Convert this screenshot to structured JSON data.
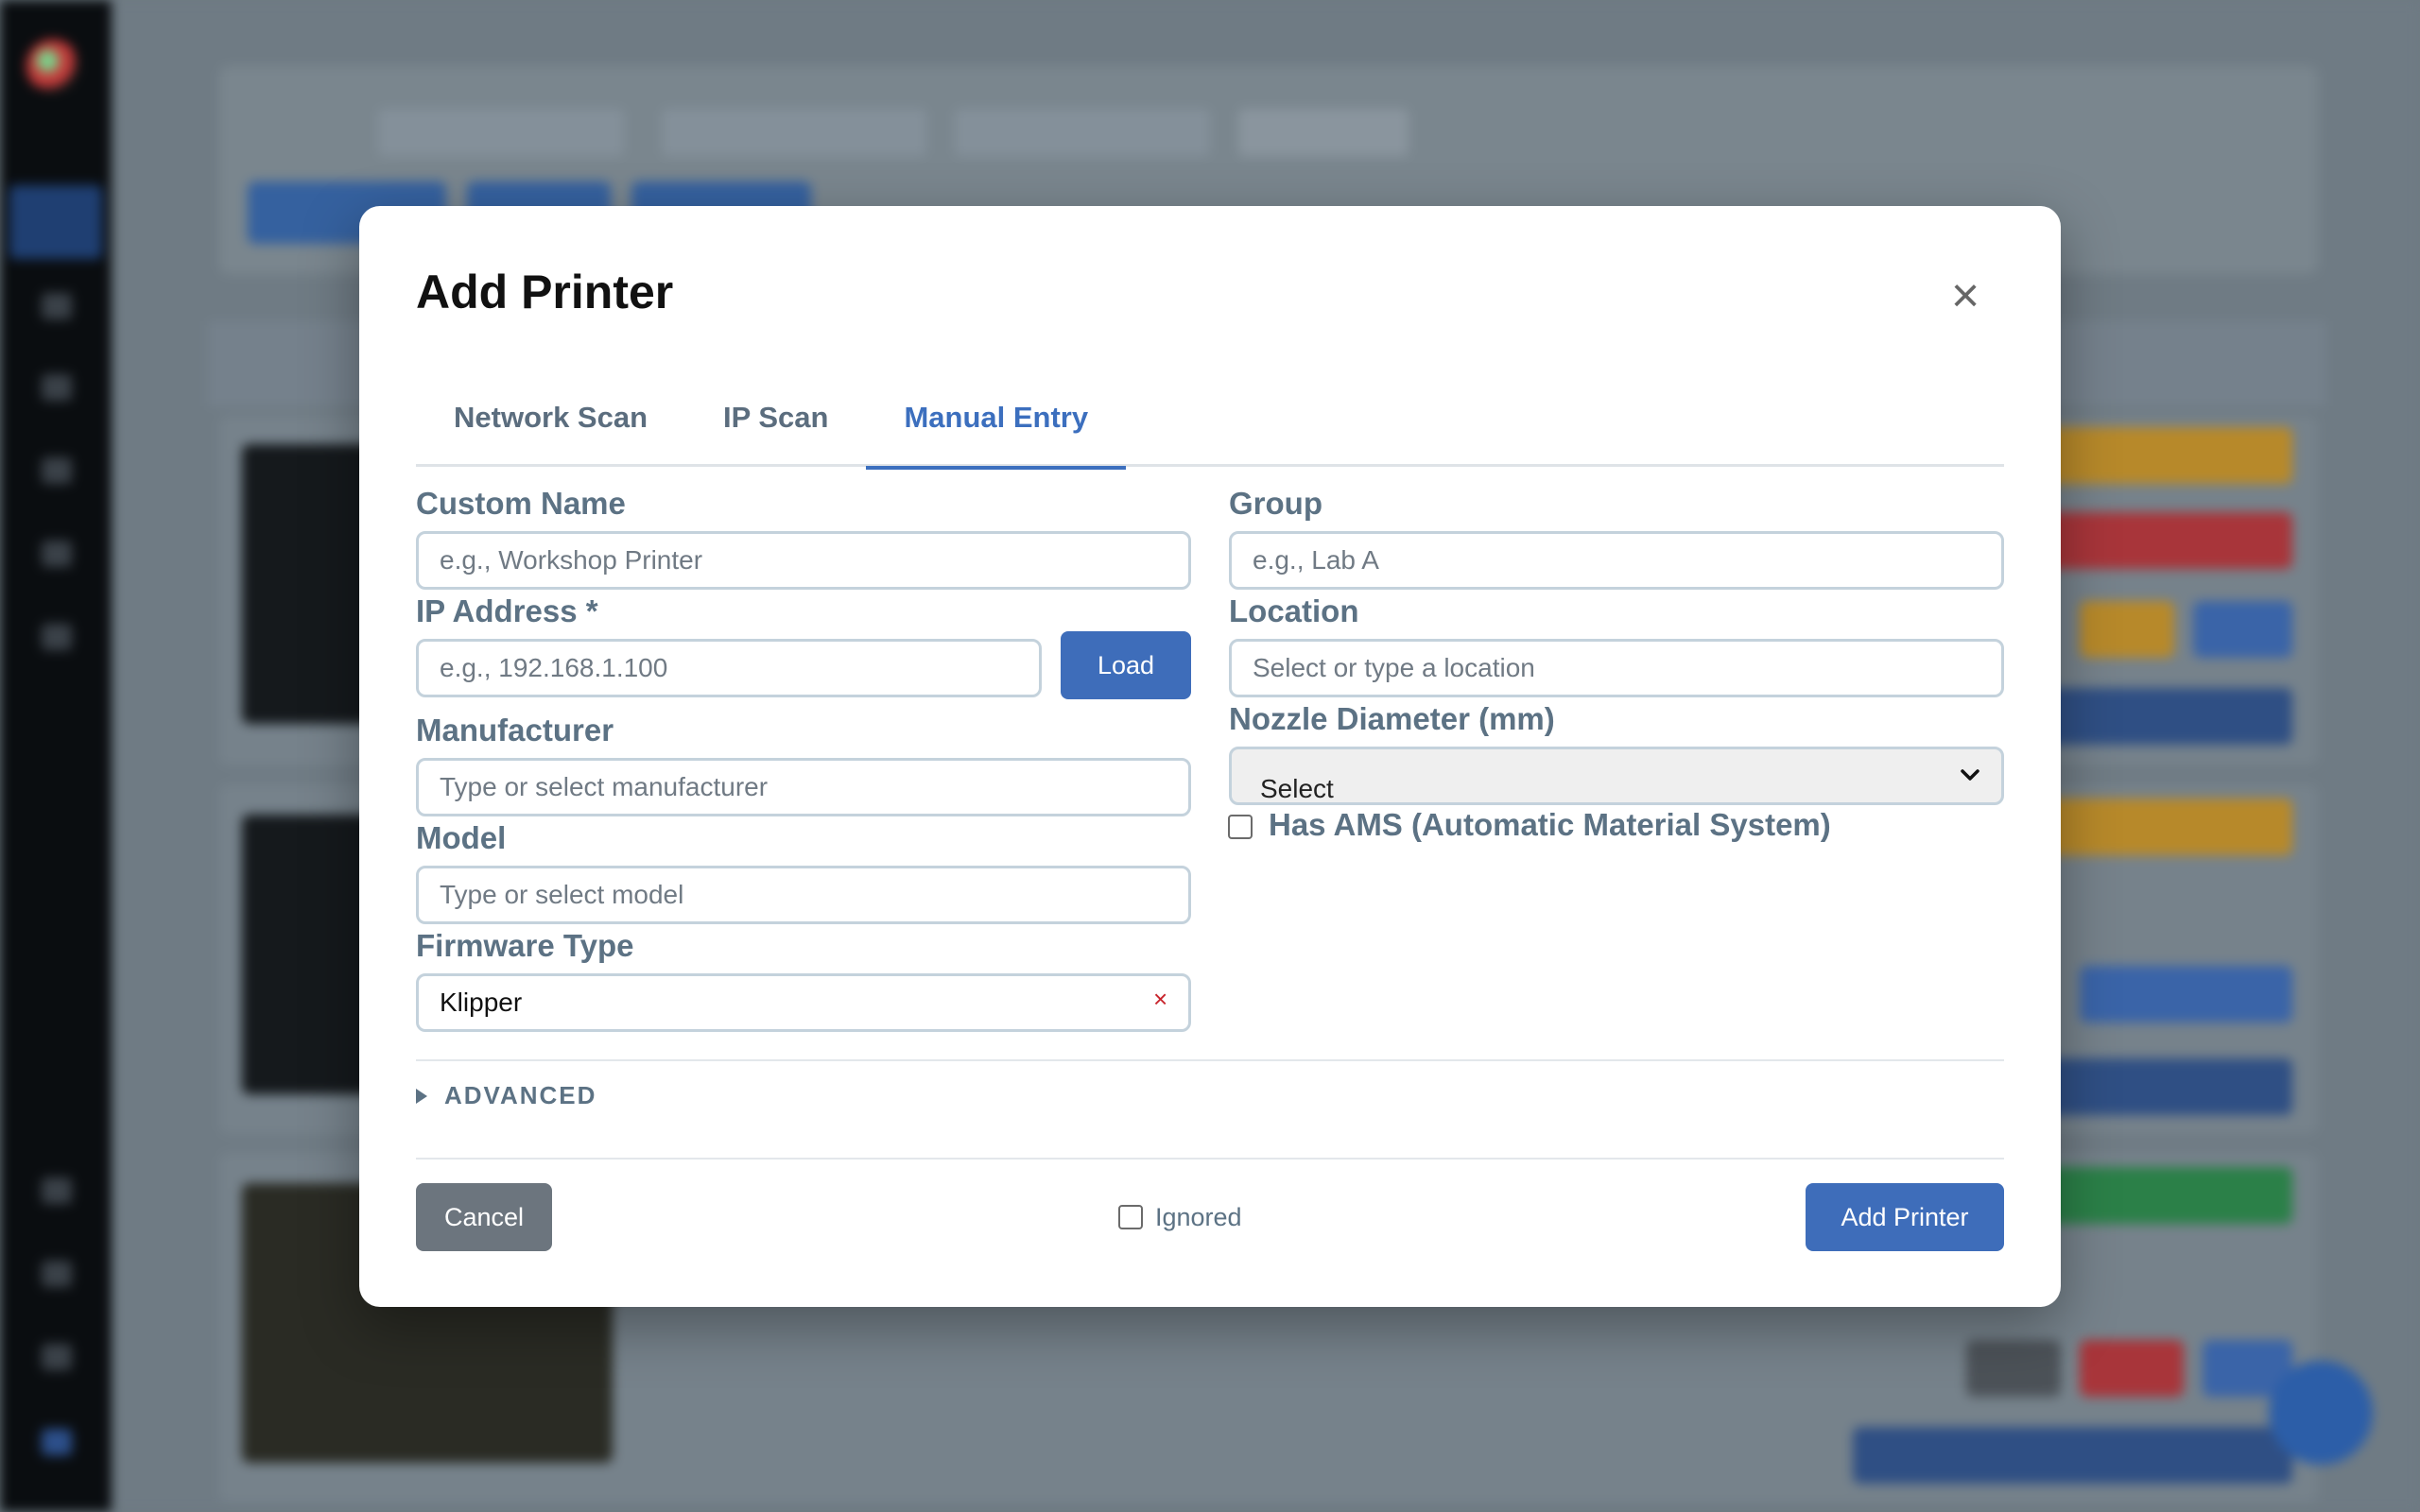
{
  "modal": {
    "title": "Add Printer",
    "close_symbol": "×",
    "tabs": [
      {
        "label": "Network Scan",
        "active": false
      },
      {
        "label": "IP Scan",
        "active": false
      },
      {
        "label": "Manual Entry",
        "active": true
      }
    ]
  },
  "form": {
    "custom_name": {
      "label": "Custom Name",
      "placeholder": "e.g., Workshop Printer",
      "value": ""
    },
    "ip_address": {
      "label": "IP Address *",
      "placeholder": "e.g., 192.168.1.100",
      "value": ""
    },
    "load_button": "Load",
    "manufacturer": {
      "label": "Manufacturer",
      "placeholder": "Type or select manufacturer",
      "value": ""
    },
    "model": {
      "label": "Model",
      "placeholder": "Type or select model",
      "value": ""
    },
    "firmware_type": {
      "label": "Firmware Type",
      "value": "Klipper",
      "clear_symbol": "×"
    },
    "group": {
      "label": "Group",
      "placeholder": "e.g., Lab A",
      "value": ""
    },
    "location": {
      "label": "Location",
      "placeholder": "Select or type a location",
      "value": ""
    },
    "nozzle_diameter": {
      "label": "Nozzle Diameter (mm)",
      "selected": "Select"
    },
    "has_ams": {
      "label": "Has AMS (Automatic Material System)",
      "checked": false
    },
    "advanced_label": "ADVANCED"
  },
  "footer": {
    "cancel_label": "Cancel",
    "ignored_label": "Ignored",
    "ignored_checked": false,
    "add_label": "Add Printer"
  },
  "colors": {
    "primary": "#3e6dba",
    "secondary": "#6c757e",
    "label": "#5c7284",
    "danger": "#c8242c",
    "overlay": "#6f7b84"
  }
}
